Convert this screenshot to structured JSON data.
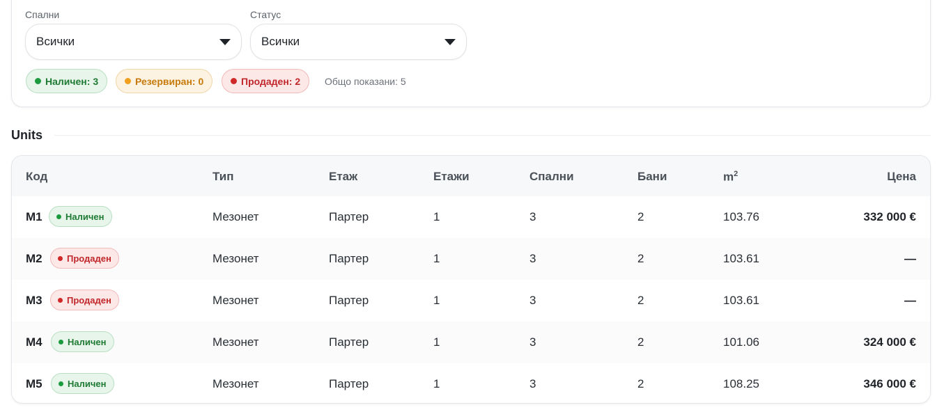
{
  "filters": {
    "bedrooms": {
      "label": "Спални",
      "value": "Всички"
    },
    "status": {
      "label": "Статус",
      "value": "Всички"
    },
    "summary": {
      "available": "Наличен: 3",
      "reserved": "Резервиран: 0",
      "sold": "Продаден: 2",
      "total": "Общо показани: 5"
    }
  },
  "section": {
    "title": "Units"
  },
  "table": {
    "headers": {
      "code": "Код",
      "type": "Тип",
      "floor": "Етаж",
      "floors": "Етажи",
      "bedrooms": "Спални",
      "baths": "Бани",
      "area": "m",
      "area_sup": "2",
      "price": "Цена"
    },
    "rows": [
      {
        "code": "M1",
        "status": "Наличен",
        "status_kind": "available",
        "type": "Мезонет",
        "floor": "Партер",
        "floors": "1",
        "bedrooms": "3",
        "baths": "2",
        "area": "103.76",
        "price": "332 000 €"
      },
      {
        "code": "M2",
        "status": "Продаден",
        "status_kind": "sold",
        "type": "Мезонет",
        "floor": "Партер",
        "floors": "1",
        "bedrooms": "3",
        "baths": "2",
        "area": "103.61",
        "price": "—"
      },
      {
        "code": "M3",
        "status": "Продаден",
        "status_kind": "sold",
        "type": "Мезонет",
        "floor": "Партер",
        "floors": "1",
        "bedrooms": "3",
        "baths": "2",
        "area": "103.61",
        "price": "—"
      },
      {
        "code": "M4",
        "status": "Наличен",
        "status_kind": "available",
        "type": "Мезонет",
        "floor": "Партер",
        "floors": "1",
        "bedrooms": "3",
        "baths": "2",
        "area": "101.06",
        "price": "324 000 €"
      },
      {
        "code": "M5",
        "status": "Наличен",
        "status_kind": "available",
        "type": "Мезонет",
        "floor": "Партер",
        "floors": "1",
        "bedrooms": "3",
        "baths": "2",
        "area": "108.25",
        "price": "346 000 €"
      }
    ]
  },
  "colors": {
    "available": "#1f7a34",
    "reserved": "#c77a0a",
    "sold": "#c0262a"
  }
}
